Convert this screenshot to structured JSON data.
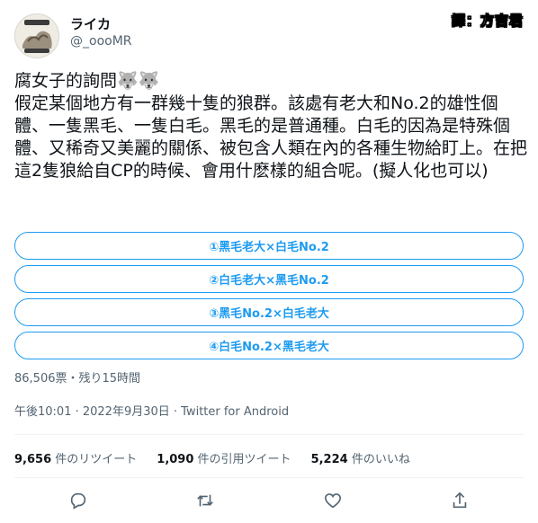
{
  "author": {
    "display_name": "ライカ",
    "handle": "@_oooMR"
  },
  "corner_badge": "譯：方吉君",
  "tweet": {
    "text": "腐女子的詢問🐺🐺\n假定某個地方有一群幾十隻的狼群。該處有老大和No.2的雄性個體、一隻黑毛、一隻白毛。黑毛的是普通種。白毛的因為是特殊個體、又稀奇又美麗的關係、被包含人類在內的各種生物給盯上。在把這2隻狼給自CP的時候、會用什麽樣的組合呢。(擬人化也可以)"
  },
  "poll": {
    "options": [
      "①黑毛老大×白毛No.2",
      "②白毛老大×黑毛No.2",
      "③黑毛No.2×白毛老大",
      "④白毛No.2×黑毛老大"
    ],
    "summary": "86,506票・残り15時間"
  },
  "timestamp_line": "午後10:01 · 2022年9月30日 · Twitter for Android",
  "stats": {
    "retweets_count": "9,656",
    "retweets_label": "件のリツイート",
    "quotes_count": "1,090",
    "quotes_label": "件の引用ツイート",
    "likes_count": "5,224",
    "likes_label": "件のいいね"
  },
  "icons": {
    "reply": "reply-icon",
    "retweet": "retweet-icon",
    "like": "heart-icon",
    "share": "share-icon"
  },
  "colors": {
    "accent": "#1d9bf0",
    "secondary_text": "#536471",
    "primary_text": "#0f1419",
    "divider": "#eff3f4"
  }
}
